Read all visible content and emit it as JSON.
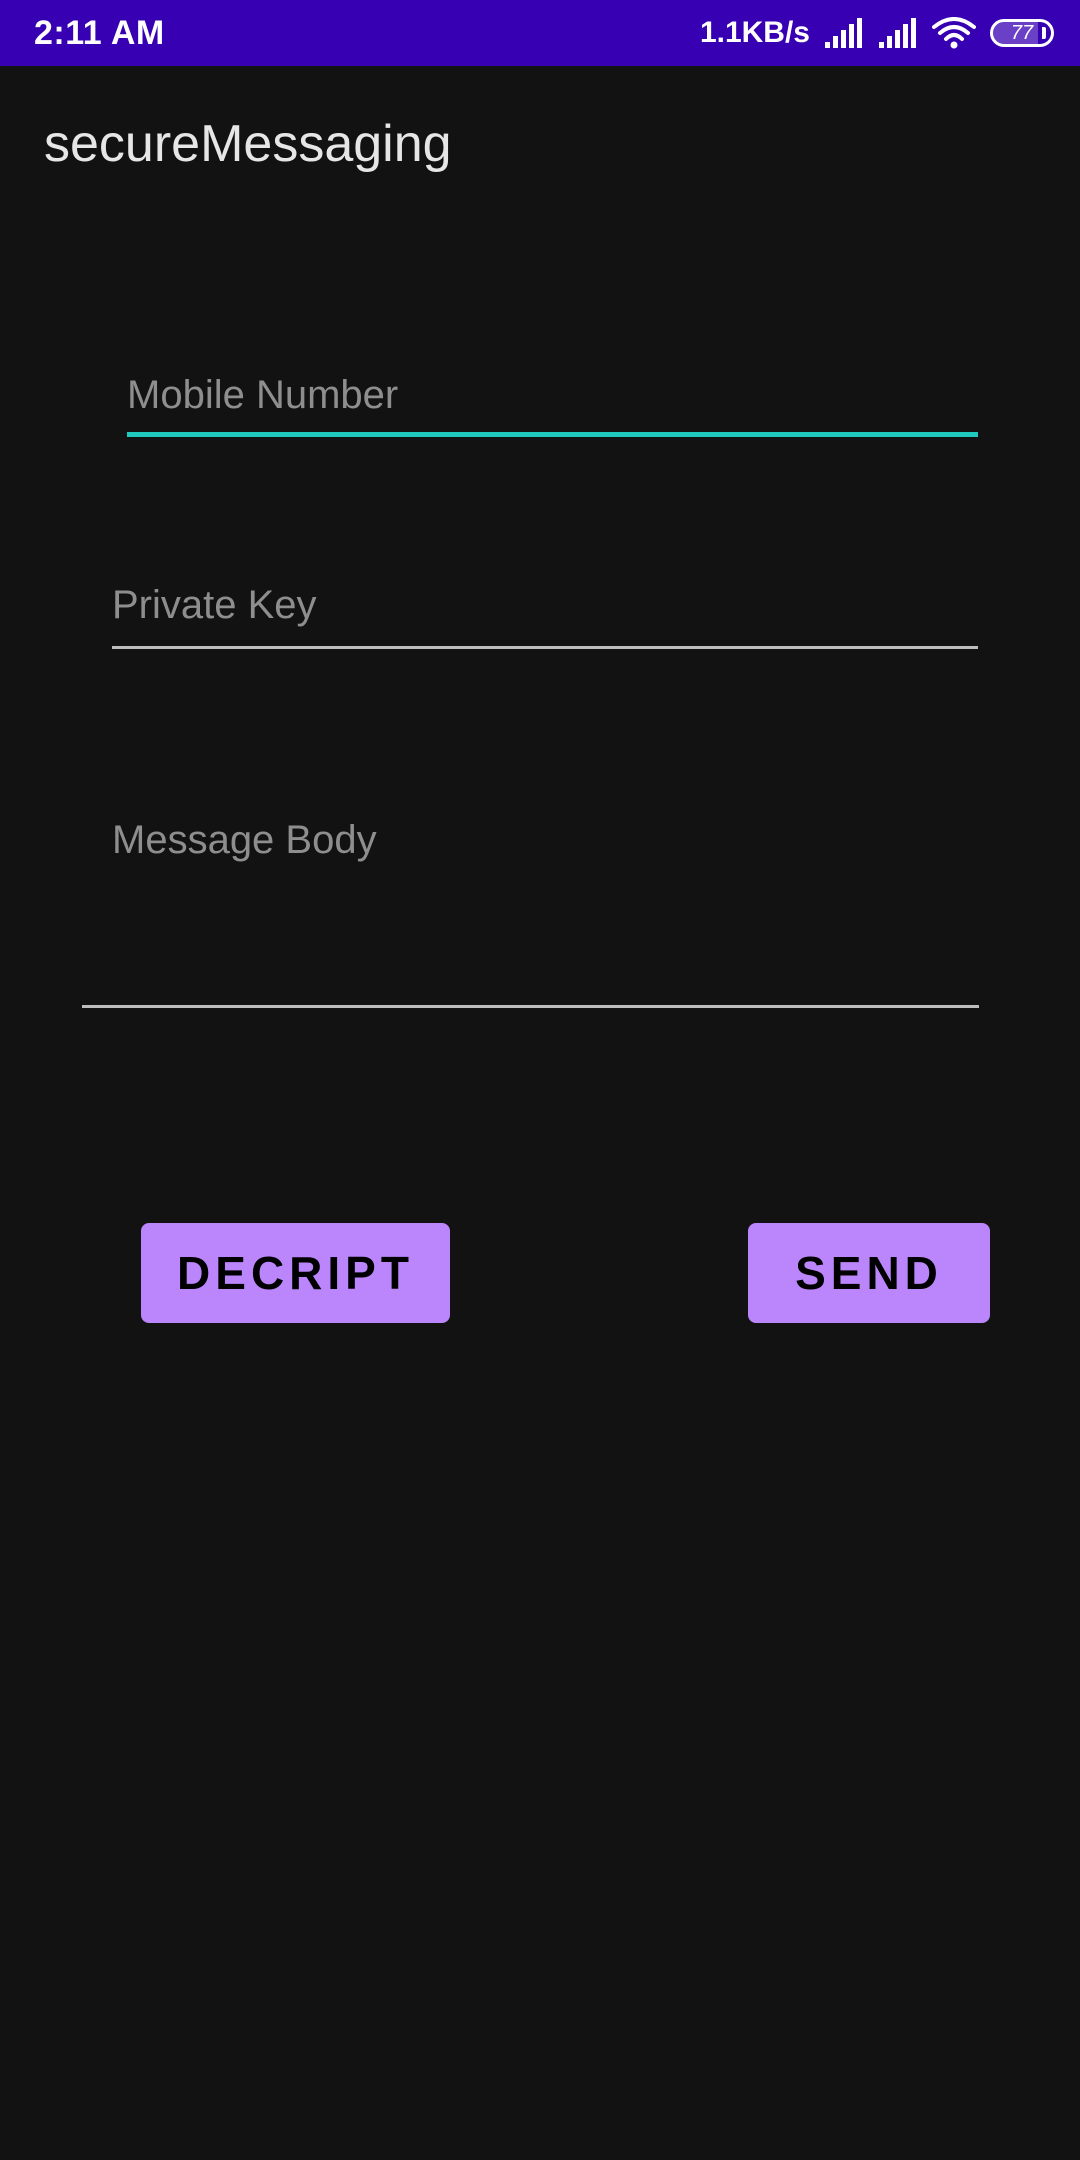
{
  "status_bar": {
    "time": "2:11 AM",
    "net_speed": "1.1KB/s",
    "battery_level": "77",
    "battery_fraction": 0.77,
    "icons": [
      "signal-icon",
      "signal-icon",
      "wifi-icon",
      "battery-icon"
    ],
    "background_color": "#3700B3"
  },
  "app_bar": {
    "title": "secureMessaging"
  },
  "form": {
    "mobile_number": {
      "placeholder": "Mobile Number",
      "value": "",
      "focused": true
    },
    "private_key": {
      "placeholder": "Private Key",
      "value": ""
    },
    "message_body": {
      "placeholder": "Message Body",
      "value": ""
    }
  },
  "buttons": {
    "decrypt_label": "DECRIPT",
    "send_label": "SEND"
  },
  "colors": {
    "background": "#121212",
    "accent": "#1fc9bf",
    "button": "#bb86fc"
  }
}
